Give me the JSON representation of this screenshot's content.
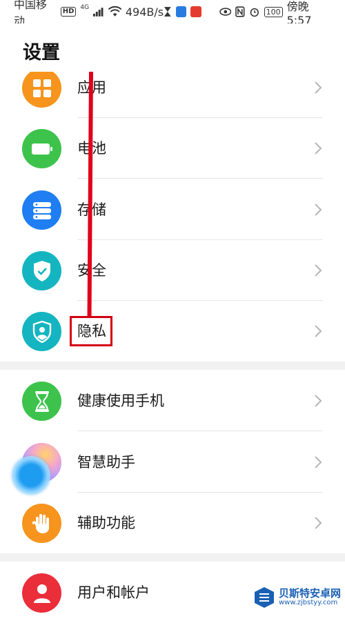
{
  "status_bar": {
    "carrier": "中国移动",
    "hd": "HD",
    "network": "4G",
    "speed": "494B/s",
    "battery": "100",
    "time": "傍晚5:57"
  },
  "page": {
    "title": "设置"
  },
  "items": [
    {
      "label": "应用",
      "icon": "apps-icon",
      "color": "#f7941d"
    },
    {
      "label": "电池",
      "icon": "battery-icon",
      "color": "#3dc34b"
    },
    {
      "label": "存储",
      "icon": "storage-icon",
      "color": "#1f7ef2"
    },
    {
      "label": "安全",
      "icon": "security-shield-icon",
      "color": "#14b5c0"
    },
    {
      "label": "隐私",
      "icon": "privacy-shield-icon",
      "color": "#14b5c0"
    },
    {
      "label": "健康使用手机",
      "icon": "hourglass-icon",
      "color": "#3dc34b"
    },
    {
      "label": "智慧助手",
      "icon": "assistant-icon",
      "color": "#c79cf7"
    },
    {
      "label": "辅助功能",
      "icon": "hand-icon",
      "color": "#f7941d"
    },
    {
      "label": "用户和帐户",
      "icon": "user-icon",
      "color": "#ea2e3a"
    }
  ],
  "watermark": {
    "name": "贝斯特安卓网",
    "url": "www.zjbstyy.com"
  }
}
